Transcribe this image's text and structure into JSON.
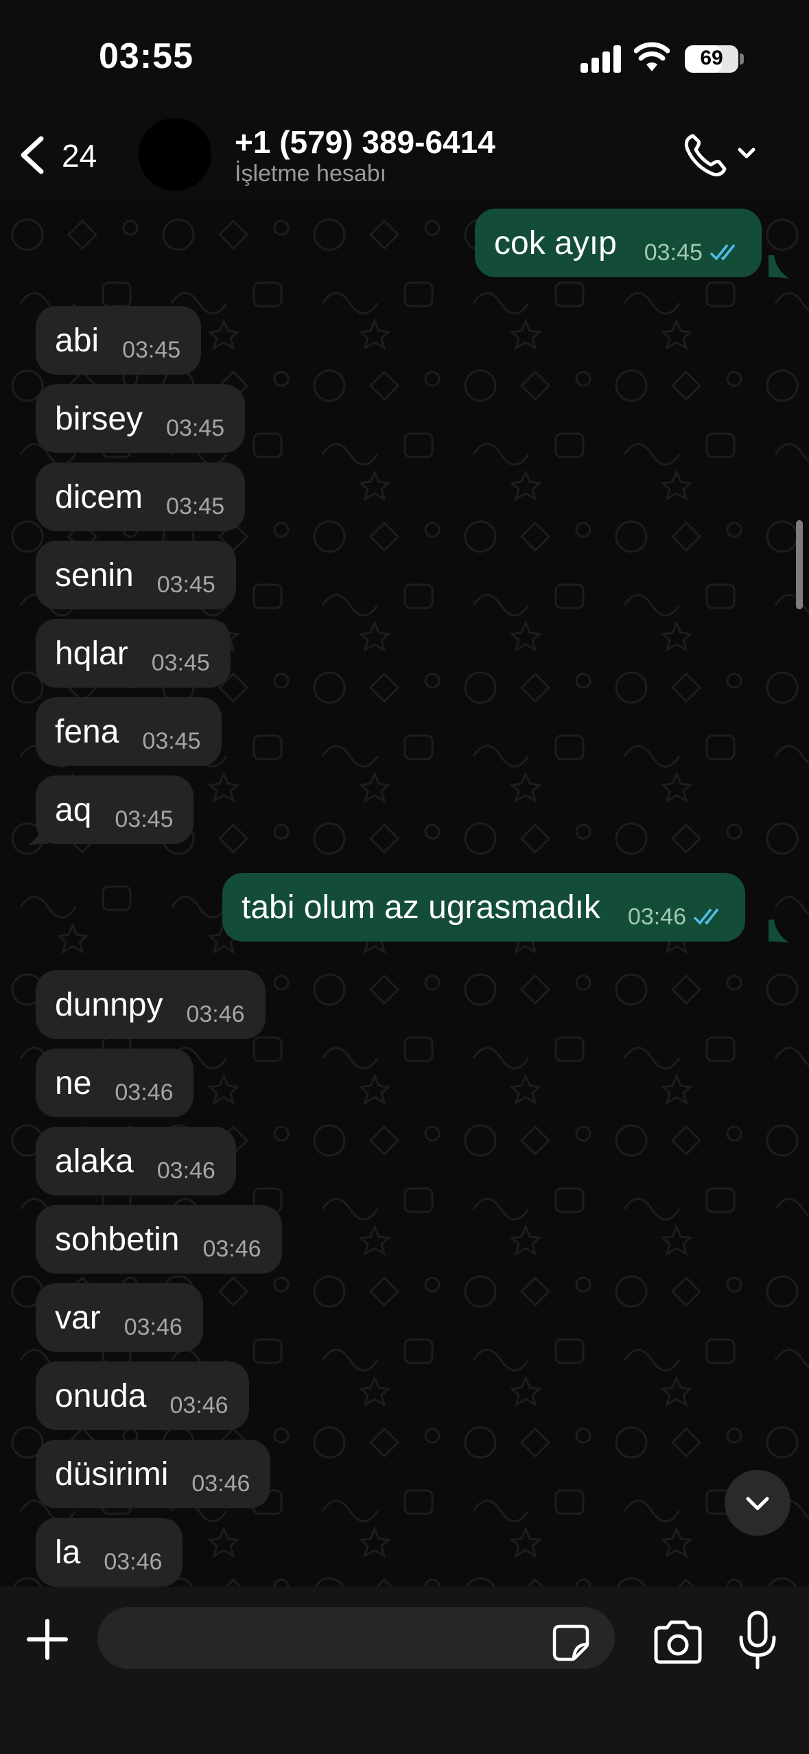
{
  "status_bar": {
    "time": "03:55",
    "battery": "69",
    "battery_level": 0.69
  },
  "header": {
    "back_count": "24",
    "contact_name": "+1 (579) 389-6414",
    "contact_subtitle": "İşletme hesabı"
  },
  "messages": [
    {
      "dir": "out",
      "text": "cok ayıp",
      "time": "03:45"
    },
    {
      "dir": "in",
      "text": "abi",
      "time": "03:45"
    },
    {
      "dir": "in",
      "text": "birsey",
      "time": "03:45"
    },
    {
      "dir": "in",
      "text": "dicem",
      "time": "03:45"
    },
    {
      "dir": "in",
      "text": "senin",
      "time": "03:45"
    },
    {
      "dir": "in",
      "text": "hqlar",
      "time": "03:45"
    },
    {
      "dir": "in",
      "text": "fena",
      "time": "03:45"
    },
    {
      "dir": "in",
      "text": "aq",
      "time": "03:45"
    },
    {
      "dir": "out",
      "text": "tabi olum az ugrasmadık",
      "time": "03:46"
    },
    {
      "dir": "in",
      "text": "dunnpy",
      "time": "03:46"
    },
    {
      "dir": "in",
      "text": "ne",
      "time": "03:46"
    },
    {
      "dir": "in",
      "text": "alaka",
      "time": "03:46"
    },
    {
      "dir": "in",
      "text": "sohbetin",
      "time": "03:46"
    },
    {
      "dir": "in",
      "text": "var",
      "time": "03:46"
    },
    {
      "dir": "in",
      "text": "onuda",
      "time": "03:46"
    },
    {
      "dir": "in",
      "text": "düsirimi",
      "time": "03:46"
    },
    {
      "dir": "in",
      "text": "la",
      "time": "03:46"
    }
  ],
  "input": {
    "placeholder": ""
  },
  "icons": {
    "back": "chevron-left-icon",
    "call": "phone-icon",
    "call_menu": "chevron-down-icon",
    "scroll_down": "chevron-down-icon",
    "attach": "plus-icon",
    "sticker": "sticker-icon",
    "camera": "camera-icon",
    "mic": "microphone-icon"
  },
  "colors": {
    "incoming_bubble": "#242424",
    "outgoing_bubble": "#134d37",
    "read_ticks": "#53bdeb",
    "background": "#0b0b0b"
  }
}
